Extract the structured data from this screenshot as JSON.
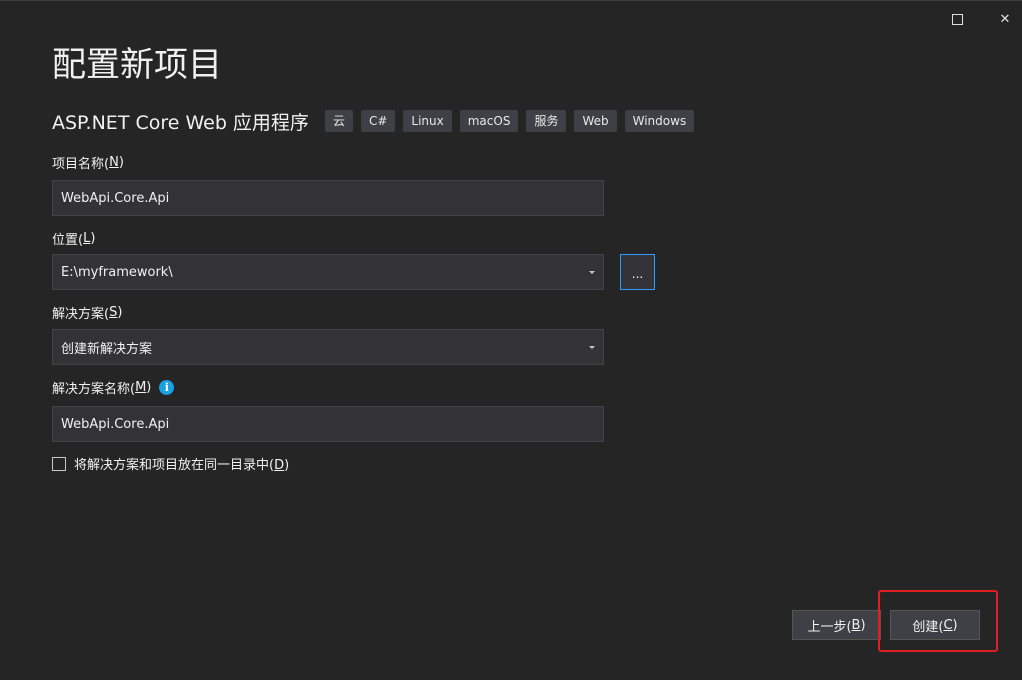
{
  "window": {
    "maximize_glyph": "",
    "close_glyph": "✕"
  },
  "page_title": "配置新项目",
  "template": {
    "name": "ASP.NET Core Web 应用程序",
    "tags": [
      "云",
      "C#",
      "Linux",
      "macOS",
      "服务",
      "Web",
      "Windows"
    ]
  },
  "project_name": {
    "label": "项目名称(",
    "mnemonic": "N",
    "label_end": ")",
    "value": "WebApi.Core.Api"
  },
  "location": {
    "label": "位置(",
    "mnemonic": "L",
    "label_end": ")",
    "value": "E:\\myframework\\",
    "browse_label": "..."
  },
  "solution": {
    "label": "解决方案(",
    "mnemonic": "S",
    "label_end": ")",
    "value": "创建新解决方案"
  },
  "solution_name": {
    "label": "解决方案名称(",
    "mnemonic": "M",
    "label_end": ")",
    "info_glyph": "i",
    "value": "WebApi.Core.Api"
  },
  "same_directory": {
    "label": "将解决方案和项目放在同一目录中(",
    "mnemonic": "D",
    "label_end": ")",
    "checked": false
  },
  "buttons": {
    "back": {
      "label": "上一步(",
      "mnemonic": "B",
      "label_end": ")"
    },
    "create": {
      "label": "创建(",
      "mnemonic": "C",
      "label_end": ")"
    }
  },
  "colors": {
    "background": "#252526",
    "input_bg": "#333337",
    "accent": "#3399ff",
    "info": "#1ba1e2",
    "highlight": "#e02020"
  }
}
